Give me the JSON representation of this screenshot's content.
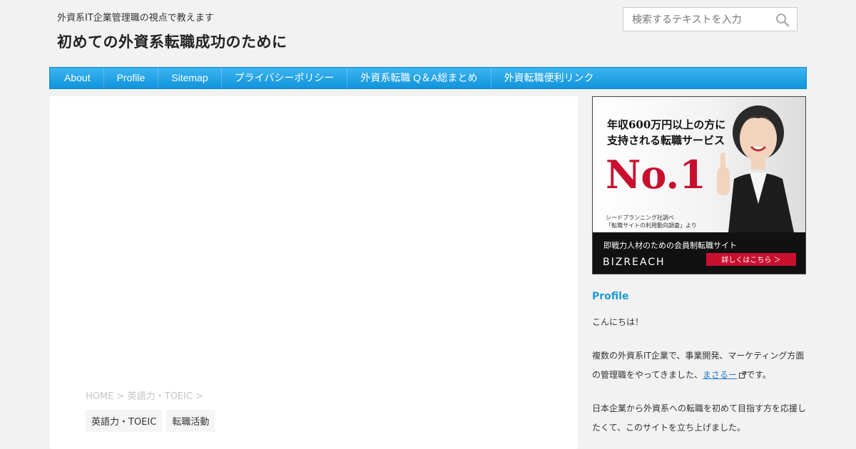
{
  "header": {
    "tagline": "外資系IT企業管理職の視点で教えます",
    "site_title": "初めての外資系転職成功のために"
  },
  "search": {
    "placeholder": "検索するテキストを入力",
    "icon": "search-icon"
  },
  "nav": {
    "items": [
      {
        "label": "About"
      },
      {
        "label": "Profile"
      },
      {
        "label": "Sitemap"
      },
      {
        "label": "プライバシーポリシー"
      },
      {
        "label": "外資系転職 Q＆A総まとめ"
      },
      {
        "label": "外資転職便利リンク"
      }
    ]
  },
  "breadcrumb": {
    "home": "HOME",
    "sep1": " > ",
    "category": "英語力・TOEIC",
    "sep2": " >"
  },
  "categories": [
    "英語力・TOEIC",
    "転職活動"
  ],
  "ad": {
    "headline_1": "年収600万円以上の方に",
    "headline_2": "支持される転職サービス",
    "big": "No.1",
    "note_1": "シードプランニング社調べ",
    "note_2": "「転職サイトの利用動向調査」より",
    "caption": "即戦力人材のための会員制転職サイト",
    "brand": "BIZREACH",
    "cta": "詳しくはこちら ＞"
  },
  "sidebar": {
    "title": "Profile",
    "greeting": "こんにちは！",
    "p2_a": "複数の外資系IT企業で、事業開発、マーケティング方面の管理職をやってきました、",
    "p2_link": "まさるー",
    "p2_b": "です。",
    "p3": "日本企業から外資系への転職を初めて目指す方を応援したくて、このサイトを立ち上げました。"
  },
  "colors": {
    "nav": "#1a9fe6",
    "accent": "#1a9ad6",
    "link": "#2a7ac8",
    "cta": "#c8102e"
  }
}
